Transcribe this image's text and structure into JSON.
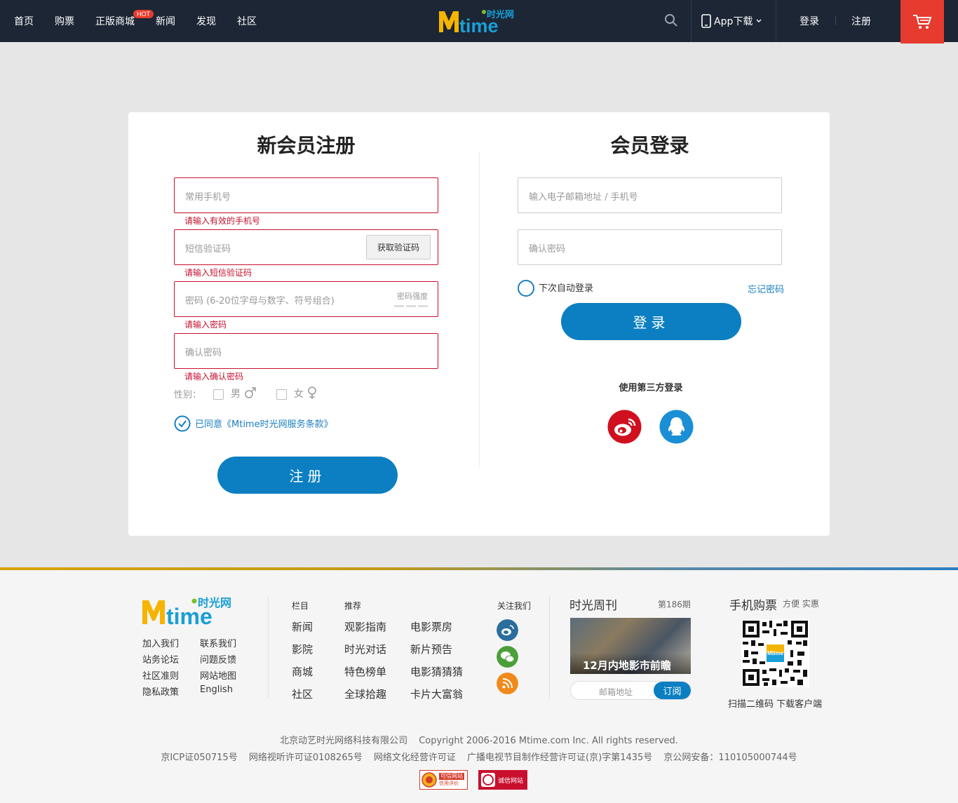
{
  "nav": {
    "items": [
      "首页",
      "购票",
      "正版商城",
      "新闻",
      "发现",
      "社区"
    ],
    "hot_badge": "HOT",
    "logo_text": "Mtime",
    "logo_cn": "时光网",
    "app_download": "App下载",
    "login": "登录",
    "register": "注册"
  },
  "register": {
    "title": "新会员注册",
    "phone_placeholder": "常用手机号",
    "phone_error": "请输入有效的手机号",
    "sms_placeholder": "短信验证码",
    "get_code": "获取验证码",
    "sms_error": "请输入短信验证码",
    "password_placeholder": "密码 (6-20位字母与数字、符号组合)",
    "strength_label": "密码强度",
    "password_error": "请输入密码",
    "confirm_placeholder": "确认密码",
    "confirm_error": "请输入确认密码",
    "gender_label": "性别：",
    "male": "男",
    "female": "女",
    "agree": "已同意《Mtime时光网服务条款》",
    "submit": "注册"
  },
  "login": {
    "title": "会员登录",
    "account_placeholder": "输入电子邮箱地址 / 手机号",
    "password_placeholder": "确认密码",
    "auto_login": "下次自动登录",
    "forgot": "忘记密码",
    "submit": "登录",
    "third_party": "使用第三方登录"
  },
  "footer": {
    "links_col1": [
      "加入我们",
      "站务论坛",
      "社区准则",
      "隐私政策"
    ],
    "links_col2": [
      "联系我们",
      "问题反馈",
      "网站地图",
      "English"
    ],
    "col_head": "栏目",
    "col_items": [
      "新闻",
      "影院",
      "商城",
      "社区"
    ],
    "rec_head": "推荐",
    "rec_col1": [
      "观影指南",
      "时光对话",
      "特色榜单",
      "全球拾趣"
    ],
    "rec_col2": [
      "电影票房",
      "新片预告",
      "电影猜猜猜",
      "卡片大富翁"
    ],
    "follow": "关注我们",
    "weekly_title": "时光周刊",
    "weekly_issue": "第186期",
    "weekly_banner": "12月内地影市前瞻",
    "email_placeholder": "邮箱地址",
    "subscribe": "订阅",
    "mobile_title": "手机购票",
    "mobile_sub": "方便 实惠",
    "qr_caption": "扫描二维码 下载客户端",
    "company": "北京动艺时光网络科技有限公司",
    "copyright": "Copyright 2006-2016 Mtime.com Inc. All rights reserved.",
    "licenses": [
      "京ICP证050715号",
      "网络视听许可证0108265号",
      "网络文化经营许可证",
      "广播电视节目制作经营许可证(京)字第1435号",
      "京公网安备：110105000744号"
    ],
    "badge1": "可信网站",
    "badge1_sub": "信用评价",
    "badge2": "诚信网站"
  }
}
